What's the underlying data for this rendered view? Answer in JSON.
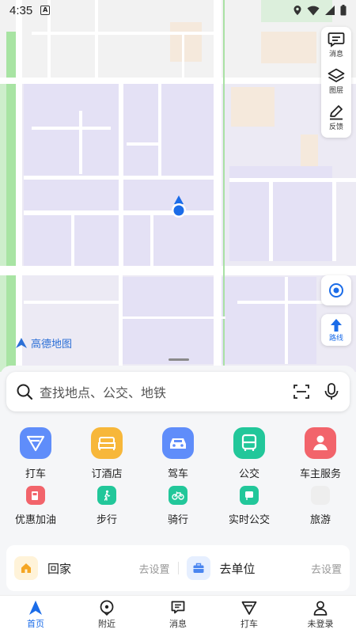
{
  "status": {
    "time": "4:35"
  },
  "toolbar": {
    "messages": "消息",
    "layers": "图层",
    "feedback": "反馈"
  },
  "route_button": "路线",
  "map_logo": "高德地图",
  "search": {
    "placeholder": "查找地点、公交、地铁"
  },
  "main_services": [
    {
      "label": "打车",
      "color": "#5f8dfa"
    },
    {
      "label": "订酒店",
      "color": "#f7b73a"
    },
    {
      "label": "驾车",
      "color": "#5f8dfa"
    },
    {
      "label": "公交",
      "color": "#22c79a"
    },
    {
      "label": "车主服务",
      "color": "#f2646b"
    }
  ],
  "small_services": [
    {
      "label": "优惠加油",
      "color": "#f2646b"
    },
    {
      "label": "步行",
      "color": "#22c79a"
    },
    {
      "label": "骑行",
      "color": "#22c79a"
    },
    {
      "label": "实时公交",
      "color": "#22c79a"
    },
    {
      "label": "旅游",
      "color": "#eeeeee"
    }
  ],
  "places": {
    "home": {
      "name": "回家",
      "action": "去设置"
    },
    "work": {
      "name": "去单位",
      "action": "去设置"
    }
  },
  "tabs": [
    {
      "label": "首页",
      "active": true
    },
    {
      "label": "附近"
    },
    {
      "label": "消息"
    },
    {
      "label": "打车"
    },
    {
      "label": "未登录"
    }
  ],
  "colors": {
    "accent": "#1b6ce8"
  }
}
